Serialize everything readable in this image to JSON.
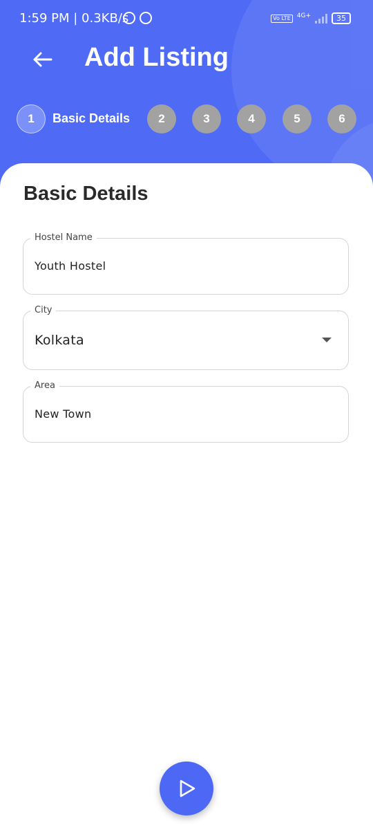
{
  "status_bar": {
    "time": "1:59 PM | 0.3KB/s",
    "volte": "Vo LTE",
    "network": "4G+",
    "battery": "35"
  },
  "header": {
    "title": "Add Listing",
    "back_icon": "arrow-left-icon"
  },
  "stepper": {
    "active_step": "1",
    "active_label": "Basic Details",
    "steps": [
      "2",
      "3",
      "4",
      "5",
      "6"
    ]
  },
  "form": {
    "section_title": "Basic Details",
    "hostel_name": {
      "label": "Hostel Name",
      "value": "Youth Hostel"
    },
    "city": {
      "label": "City",
      "value": "Kolkata"
    },
    "area": {
      "label": "Area",
      "value": "New Town"
    }
  },
  "fab": {
    "icon": "play-arrow-icon"
  },
  "colors": {
    "primary": "#4f6bf6",
    "step_inactive": "#a2a2a2",
    "field_border": "#d4d4d4"
  }
}
